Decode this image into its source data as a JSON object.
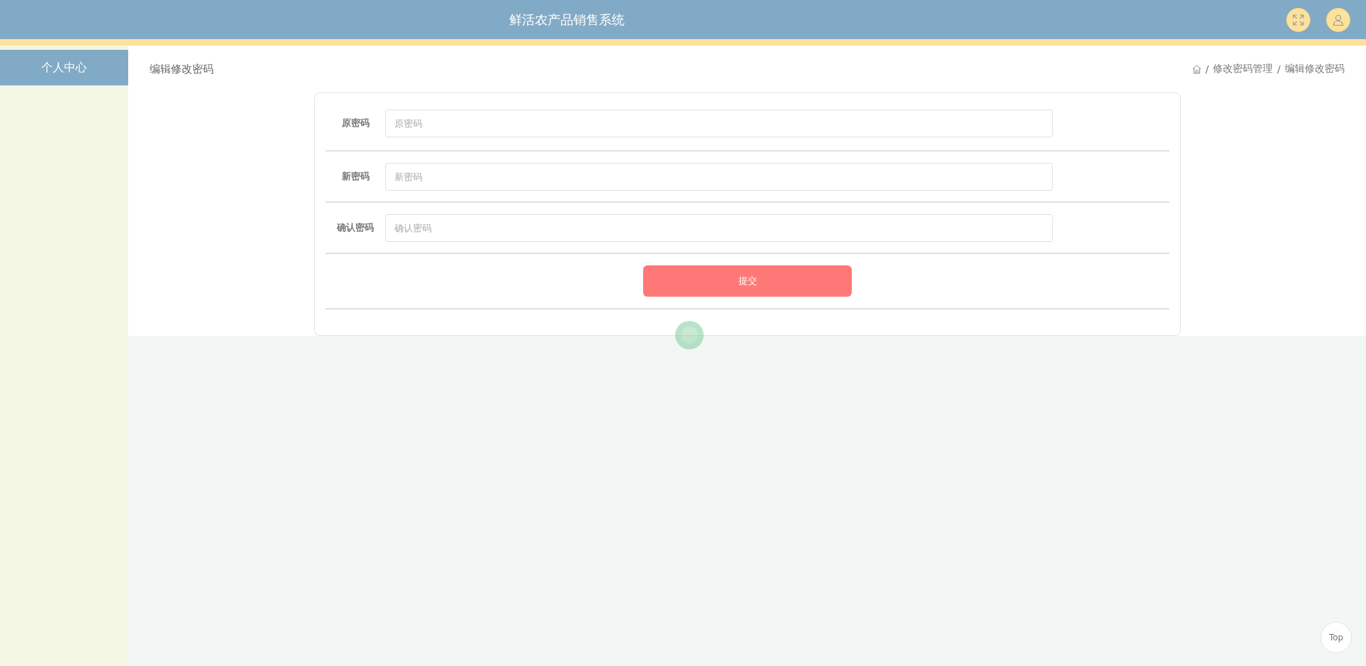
{
  "header": {
    "title": "鲜活农产品销售系统"
  },
  "sidebar": {
    "items": [
      {
        "label": "个人中心",
        "selected": true
      }
    ]
  },
  "page_title": "编辑修改密码",
  "breadcrumb": [
    {
      "separator": "/",
      "label": "修改密码管理"
    },
    {
      "separator": "/",
      "label": "编辑修改密码"
    }
  ],
  "form": {
    "fields": [
      {
        "label": "原密码",
        "placeholder": "原密码"
      },
      {
        "label": "新密码",
        "placeholder": "新密码"
      },
      {
        "label": "确认密码",
        "placeholder": "确认密码"
      }
    ],
    "submit": "提交"
  },
  "back_to_top": "Top"
}
